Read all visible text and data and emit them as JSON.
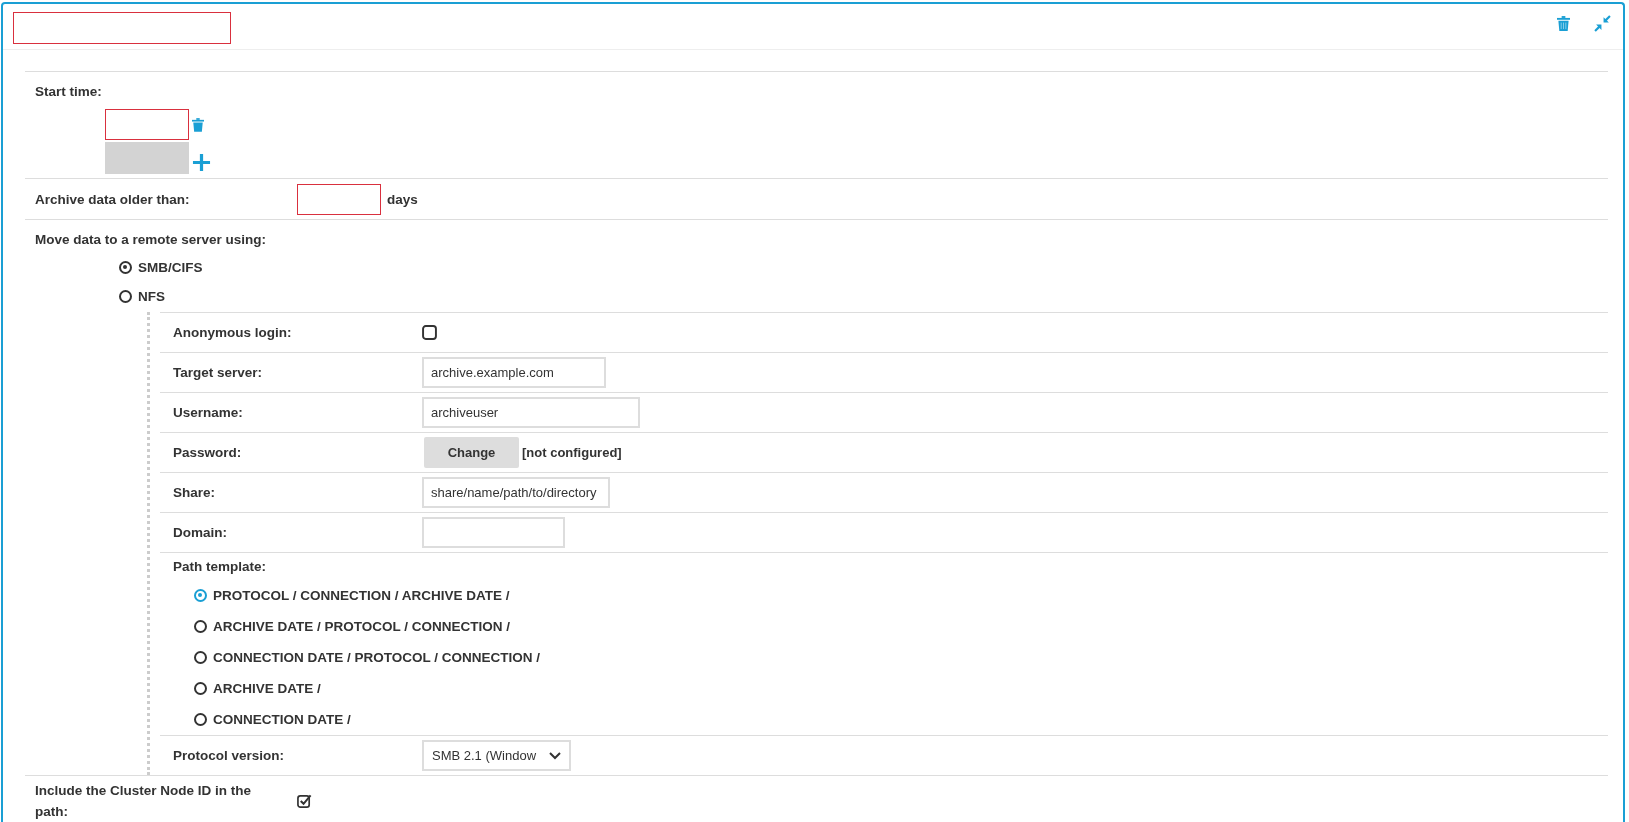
{
  "header": {
    "name_field": {
      "invalid": true
    }
  },
  "start_time": {
    "label": "Start time:",
    "entries": [
      {
        "invalid": true
      }
    ],
    "new_entry": {
      "disabled": true
    }
  },
  "archive": {
    "label": "Archive data older than:",
    "field": {
      "invalid": true
    },
    "unit": "days"
  },
  "move_data": {
    "label": "Move data to a remote server using:",
    "protocols": [
      {
        "label": "SMB/CIFS",
        "selected": true
      },
      {
        "label": "NFS",
        "selected": false
      }
    ],
    "settings": [
      {
        "kind": "checkbox",
        "label": "Anonymous login:",
        "checked": false
      },
      {
        "kind": "text",
        "label": "Target server:",
        "value": "archive.example.com"
      },
      {
        "kind": "text",
        "label": "Username:",
        "value": "archiveuser"
      },
      {
        "kind": "password",
        "label": "Password:",
        "button": "Change",
        "status": "[not configured]"
      },
      {
        "kind": "text",
        "label": "Share:",
        "value": "share/name/path/to/directory"
      },
      {
        "kind": "text",
        "label": "Domain:"
      },
      {
        "kind": "radios",
        "label": "Path template:",
        "options": [
          {
            "label": "PROTOCOL / CONNECTION / ARCHIVE DATE /",
            "selected": true
          },
          {
            "label": "ARCHIVE DATE / PROTOCOL / CONNECTION /",
            "selected": false
          },
          {
            "label": "CONNECTION DATE / PROTOCOL / CONNECTION /",
            "selected": false
          },
          {
            "label": "ARCHIVE DATE /",
            "selected": false
          },
          {
            "label": "CONNECTION DATE /",
            "selected": false
          }
        ]
      },
      {
        "kind": "select",
        "label": "Protocol version:",
        "value": "SMB 2.1 (Window"
      }
    ]
  },
  "include_node_id": {
    "label": "Include the Cluster Node ID in the path:",
    "checked": true
  }
}
